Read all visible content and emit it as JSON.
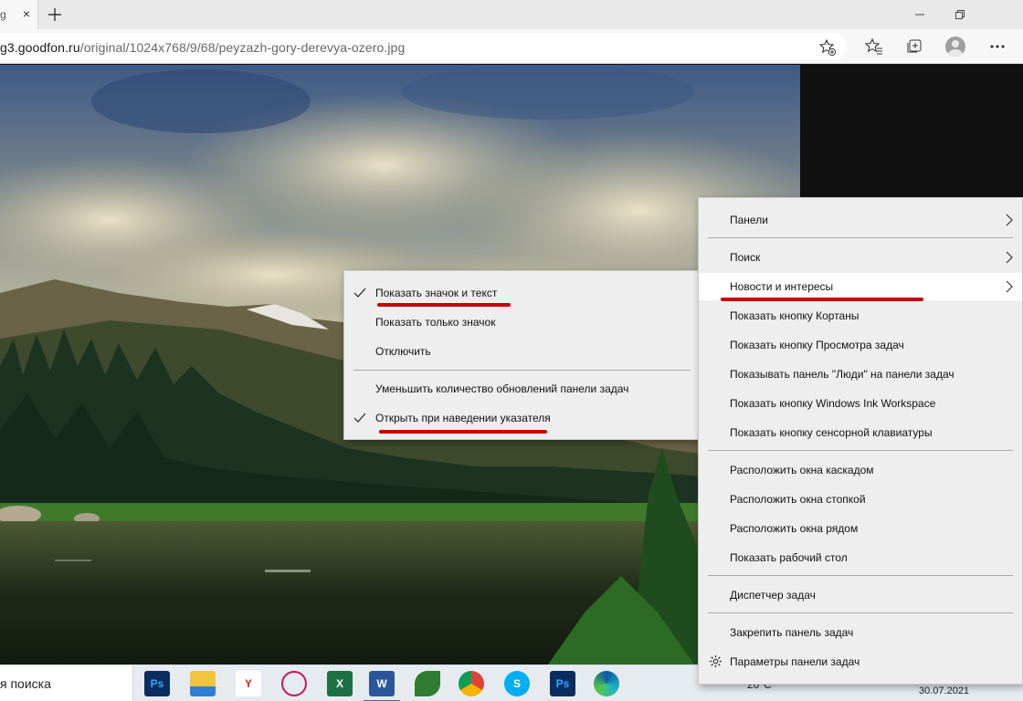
{
  "browser": {
    "tab_text": "g",
    "tab_close_glyph": "×",
    "url_host": "g3.goodfon.ru",
    "url_path": "/original/1024x768/9/68/peyzazh-gory-derevya-ozero.jpg"
  },
  "icons": {
    "new_tab": "plus-icon",
    "minimize": "minimize-icon",
    "restore": "restore-icon",
    "add_favorite": "star-plus-icon",
    "favorites": "favorites-icon",
    "collections": "collections-icon",
    "profile": "avatar-icon",
    "more": "ellipsis-icon",
    "settings": "gear-icon"
  },
  "taskbar": {
    "search_text": "я поиска",
    "temperature": "20°C",
    "date": "30.07.2021",
    "apps": [
      {
        "name": "photoshop",
        "label": "Ps",
        "color": "#0b2c5e",
        "fg": "#31a8ff"
      },
      {
        "name": "file-explorer",
        "label": "",
        "color": "#f2c33c",
        "fg": "#ffffff"
      },
      {
        "name": "yandex-browser",
        "label": "Y",
        "color": "#ffffff",
        "fg": "#e31e24"
      },
      {
        "name": "paint",
        "label": "",
        "color": "#ffffff",
        "fg": "#c2185b"
      },
      {
        "name": "excel",
        "label": "X",
        "color": "#1d7044",
        "fg": "#ffffff"
      },
      {
        "name": "word",
        "label": "W",
        "color": "#2b579a",
        "fg": "#ffffff"
      },
      {
        "name": "leaf-app",
        "label": "",
        "color": "#2e7d32",
        "fg": "#ffffff"
      },
      {
        "name": "chrome",
        "label": "",
        "color": "#ffffff",
        "fg": "#ffffff"
      },
      {
        "name": "skype",
        "label": "S",
        "color": "#00aff0",
        "fg": "#ffffff"
      },
      {
        "name": "photoshop-2",
        "label": "Ps",
        "color": "#0b2c5e",
        "fg": "#31a8ff"
      },
      {
        "name": "edge",
        "label": "",
        "color": "#ffffff",
        "fg": "#ffffff"
      }
    ]
  },
  "submenu": {
    "items": [
      {
        "label": "Показать значок и текст",
        "checked": true
      },
      {
        "label": "Показать только значок",
        "checked": false
      },
      {
        "label": "Отключить",
        "checked": false
      },
      {
        "label": "Уменьшить количество обновлений панели задач",
        "checked": false
      },
      {
        "label": "Открыть при наведении указателя",
        "checked": true
      }
    ]
  },
  "menu": {
    "items": [
      {
        "label": "Панели",
        "submenu": true
      },
      {
        "label": "Поиск",
        "submenu": true
      },
      {
        "label": "Новости и интересы",
        "submenu": true,
        "highlighted": true
      },
      {
        "label": "Показать кнопку Кортаны"
      },
      {
        "label": "Показать кнопку Просмотра задач"
      },
      {
        "label": "Показывать панель \"Люди\" на панели задач"
      },
      {
        "label": "Показать кнопку Windows Ink Workspace"
      },
      {
        "label": "Показать кнопку сенсорной клавиатуры"
      },
      {
        "label": "Расположить окна каскадом"
      },
      {
        "label": "Расположить окна стопкой"
      },
      {
        "label": "Расположить окна рядом"
      },
      {
        "label": "Показать рабочий стол"
      },
      {
        "label": "Диспетчер задач"
      },
      {
        "label": "Закрепить панель задач"
      },
      {
        "label": "Параметры панели задач",
        "icon": "gear-icon"
      }
    ]
  },
  "colors": {
    "accent_underline": "#c80000",
    "menu_bg": "#eeeeee",
    "highlight_bg": "#ffffff"
  }
}
